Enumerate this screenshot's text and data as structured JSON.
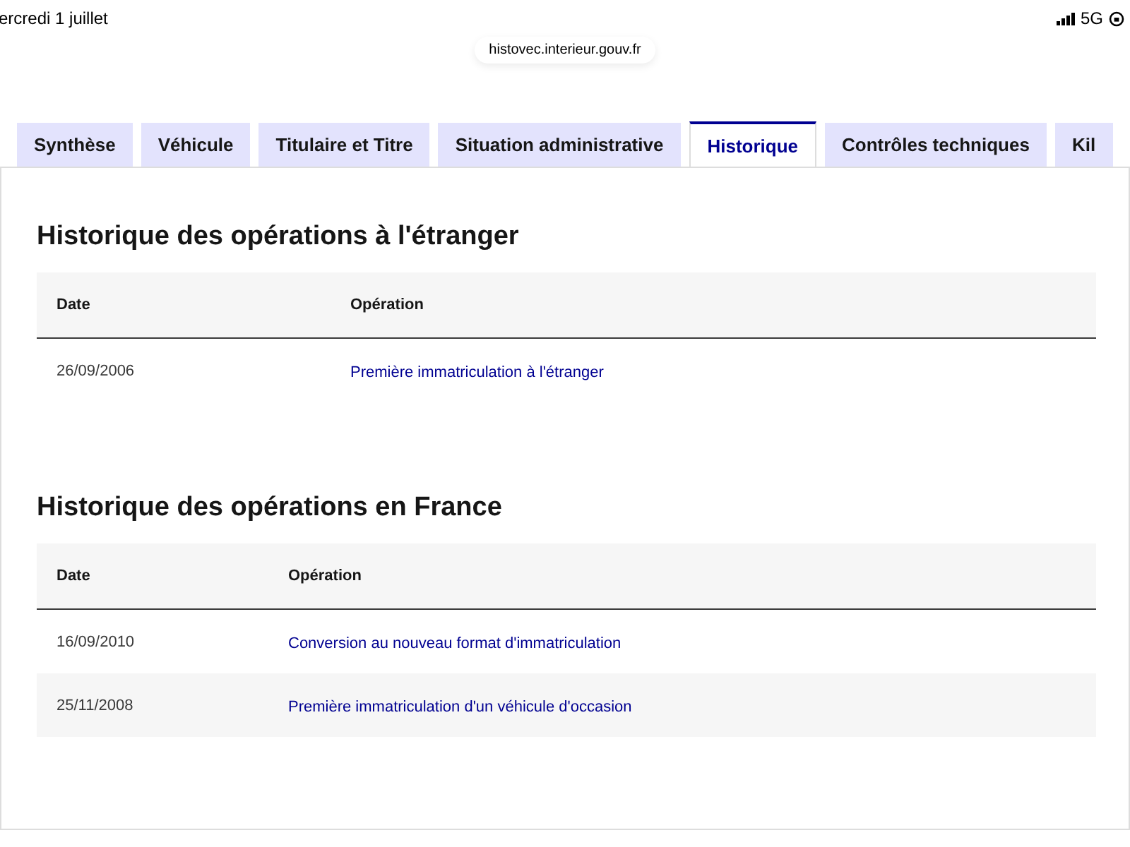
{
  "status_bar": {
    "date": "ercredi 1 juillet",
    "network": "5G"
  },
  "address_bar": {
    "url": "histovec.interieur.gouv.fr"
  },
  "tabs": [
    {
      "label": "Synthèse",
      "selected": false
    },
    {
      "label": "Véhicule",
      "selected": false
    },
    {
      "label": "Titulaire et Titre",
      "selected": false
    },
    {
      "label": "Situation administrative",
      "selected": false
    },
    {
      "label": "Historique",
      "selected": true
    },
    {
      "label": "Contrôles techniques",
      "selected": false
    },
    {
      "label": "Kil",
      "selected": false
    }
  ],
  "sections": [
    {
      "title": "Historique des opérations à l'étranger",
      "columns": [
        "Date",
        "Opération"
      ],
      "rows": [
        {
          "date": "26/09/2006",
          "operation": "Première immatriculation à l'étranger"
        }
      ]
    },
    {
      "title": "Historique des opérations en France",
      "columns": [
        "Date",
        "Opération"
      ],
      "rows": [
        {
          "date": "16/09/2010",
          "operation": "Conversion au nouveau format d'immatriculation"
        },
        {
          "date": "25/11/2008",
          "operation": "Première immatriculation d'un véhicule d'occasion"
        }
      ]
    }
  ]
}
